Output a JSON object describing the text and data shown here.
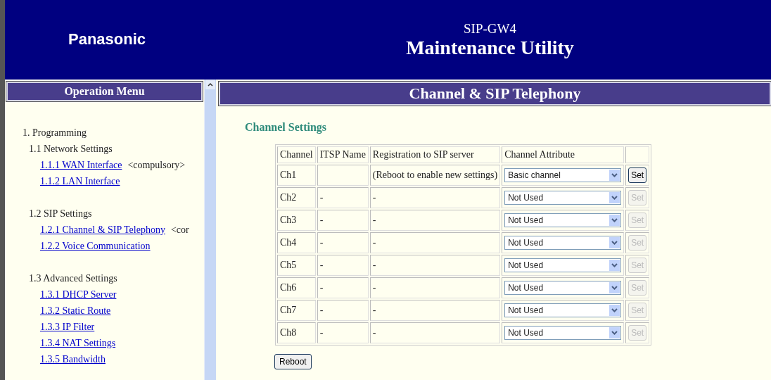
{
  "header": {
    "logo": "Panasonic",
    "product": "SIP-GW4",
    "title": "Maintenance Utility"
  },
  "sidebar": {
    "heading": "Operation Menu",
    "items": [
      {
        "label": "1. Programming",
        "children": [
          {
            "label": "1.1 Network Settings",
            "children": [
              {
                "label": "1.1.1 WAN Interface",
                "note": "<compulsory>"
              },
              {
                "label": "1.1.2 LAN Interface"
              }
            ]
          },
          {
            "label": "1.2 SIP Settings",
            "children": [
              {
                "label": "1.2.1 Channel & SIP Telephony",
                "note": "<cor"
              },
              {
                "label": "1.2.2 Voice Communication"
              }
            ]
          },
          {
            "label": "1.3 Advanced Settings",
            "children": [
              {
                "label": "1.3.1 DHCP Server"
              },
              {
                "label": "1.3.2 Static Route"
              },
              {
                "label": "1.3.3 IP Filter"
              },
              {
                "label": "1.3.4 NAT Settings"
              },
              {
                "label": "1.3.5 Bandwidth"
              }
            ]
          }
        ]
      }
    ]
  },
  "main": {
    "heading": "Channel & SIP Telephony",
    "section": "Channel Settings",
    "table": {
      "columns": [
        "Channel",
        "ITSP Name",
        "Registration to SIP server",
        "Channel Attribute"
      ],
      "rows": [
        {
          "channel": "Ch1",
          "itsp": "",
          "registration": "(Reboot to enable new settings)",
          "attribute": "Basic channel",
          "button": "Set",
          "disabled": false
        },
        {
          "channel": "Ch2",
          "itsp": "-",
          "registration": "-",
          "attribute": "Not Used",
          "button": "Set",
          "disabled": true
        },
        {
          "channel": "Ch3",
          "itsp": "-",
          "registration": "-",
          "attribute": "Not Used",
          "button": "Set",
          "disabled": true
        },
        {
          "channel": "Ch4",
          "itsp": "-",
          "registration": "-",
          "attribute": "Not Used",
          "button": "Set",
          "disabled": true
        },
        {
          "channel": "Ch5",
          "itsp": "-",
          "registration": "-",
          "attribute": "Not Used",
          "button": "Set",
          "disabled": true
        },
        {
          "channel": "Ch6",
          "itsp": "-",
          "registration": "-",
          "attribute": "Not Used",
          "button": "Set",
          "disabled": true
        },
        {
          "channel": "Ch7",
          "itsp": "-",
          "registration": "-",
          "attribute": "Not Used",
          "button": "Set",
          "disabled": true
        },
        {
          "channel": "Ch8",
          "itsp": "-",
          "registration": "-",
          "attribute": "Not Used",
          "button": "Set",
          "disabled": true
        }
      ]
    },
    "reboot": "Reboot"
  }
}
